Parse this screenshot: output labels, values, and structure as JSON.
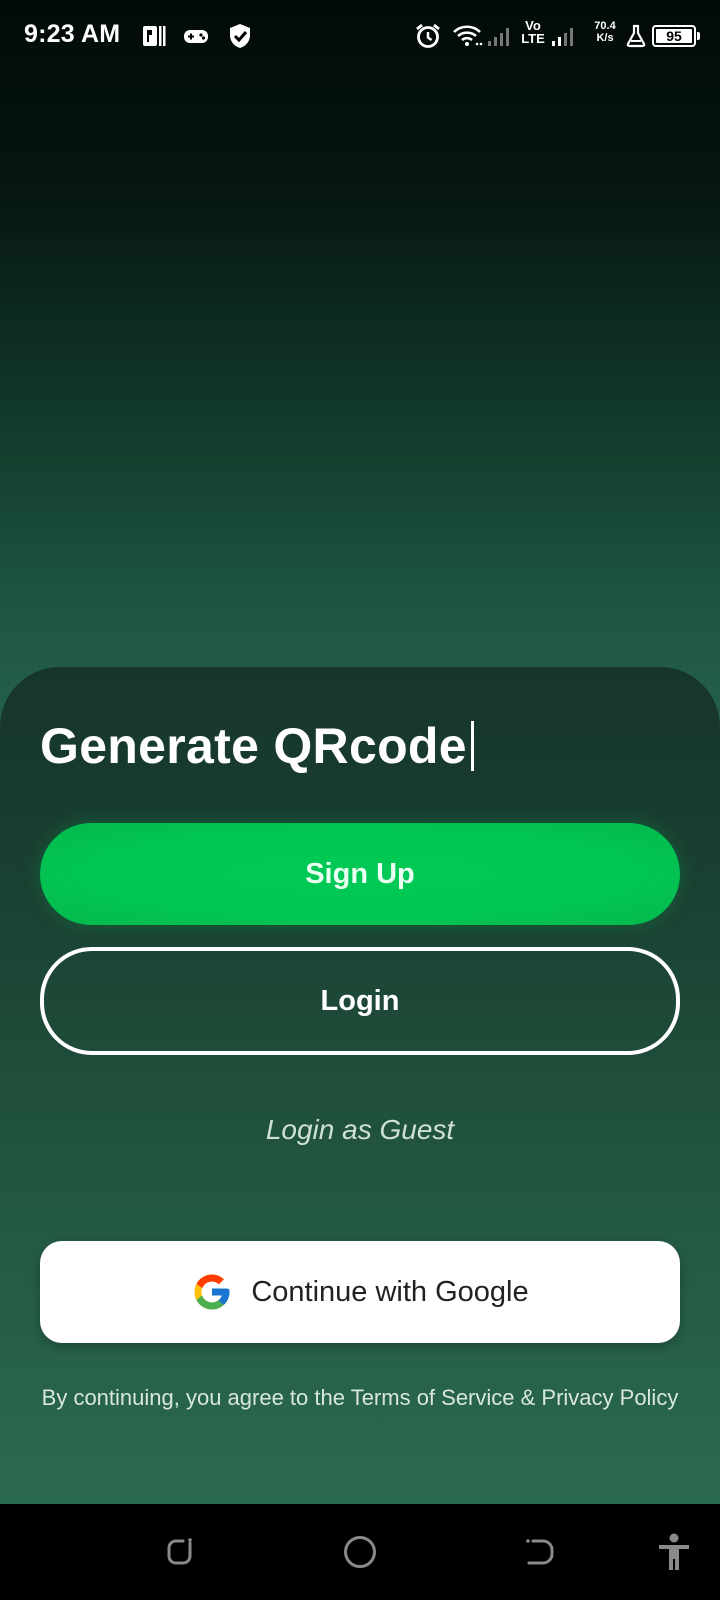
{
  "status_bar": {
    "time": "9:23 AM",
    "left_icons": [
      "parking-notification-icon",
      "game-controller-icon",
      "shield-check-icon"
    ],
    "right_icons": [
      "alarm-icon",
      "wifi-icon",
      "signal-icon",
      "signal-icon",
      "lab-flask-icon"
    ],
    "volte_label": "Vo LTE",
    "net_speed_value": "70.4",
    "net_speed_unit": "K/s",
    "battery": "95"
  },
  "main": {
    "headline": "Generate QRcode",
    "signup_label": "Sign Up",
    "login_label": "Login",
    "guest_label": "Login as Guest",
    "google_label": "Continue with Google",
    "terms_text": "By continuing, you agree to the Terms of Service & Privacy Policy"
  },
  "colors": {
    "signup_green": "#00c653",
    "background_dark": "#020a07",
    "background_green": "#2a6b52",
    "sheet": "#1b4233"
  },
  "nav_bar": {
    "icons": [
      "recent-apps-icon",
      "home-icon",
      "back-icon",
      "accessibility-icon"
    ]
  }
}
